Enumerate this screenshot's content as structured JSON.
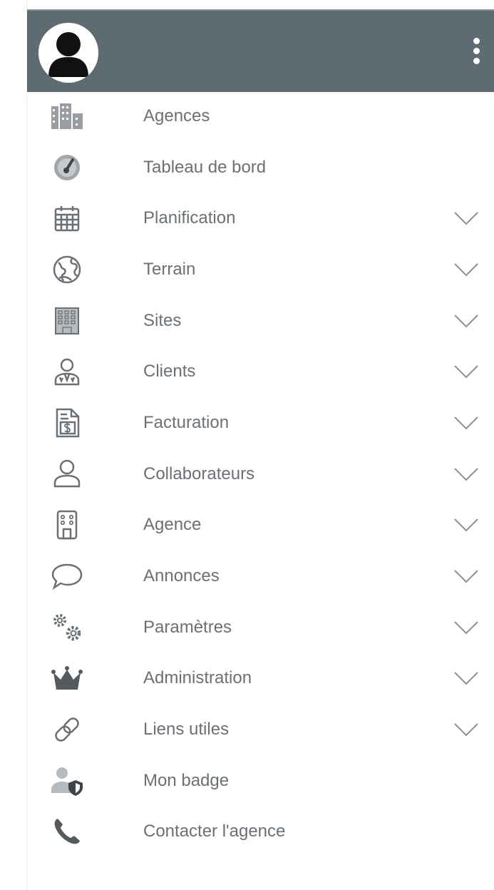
{
  "header": {
    "background_color": "#5f6b72",
    "avatar_icon": "user-avatar-icon",
    "menu_icon": "kebab-menu-icon"
  },
  "menu": {
    "items": [
      {
        "label": "Agences",
        "icon": "buildings-icon",
        "expandable": false
      },
      {
        "label": "Tableau de bord",
        "icon": "dashboard-gauge-icon",
        "expandable": false
      },
      {
        "label": "Planification",
        "icon": "calendar-icon",
        "expandable": true
      },
      {
        "label": "Terrain",
        "icon": "globe-icon",
        "expandable": true
      },
      {
        "label": "Sites",
        "icon": "building-grid-icon",
        "expandable": true
      },
      {
        "label": "Clients",
        "icon": "client-user-icon",
        "expandable": true
      },
      {
        "label": "Facturation",
        "icon": "invoice-icon",
        "expandable": true
      },
      {
        "label": "Collaborateurs",
        "icon": "person-icon",
        "expandable": true
      },
      {
        "label": "Agence",
        "icon": "office-building-icon",
        "expandable": true
      },
      {
        "label": "Annonces",
        "icon": "speech-bubble-icon",
        "expandable": true
      },
      {
        "label": "Paramètres",
        "icon": "gears-icon",
        "expandable": true
      },
      {
        "label": "Administration",
        "icon": "crown-icon",
        "expandable": true
      },
      {
        "label": "Liens utiles",
        "icon": "link-icon",
        "expandable": true
      },
      {
        "label": "Mon badge",
        "icon": "user-shield-icon",
        "expandable": false
      },
      {
        "label": "Contacter l'agence",
        "icon": "phone-icon",
        "expandable": false
      }
    ]
  },
  "colors": {
    "text": "#6b7075",
    "icon": "#8c9094",
    "chevron": "#8c9094"
  }
}
